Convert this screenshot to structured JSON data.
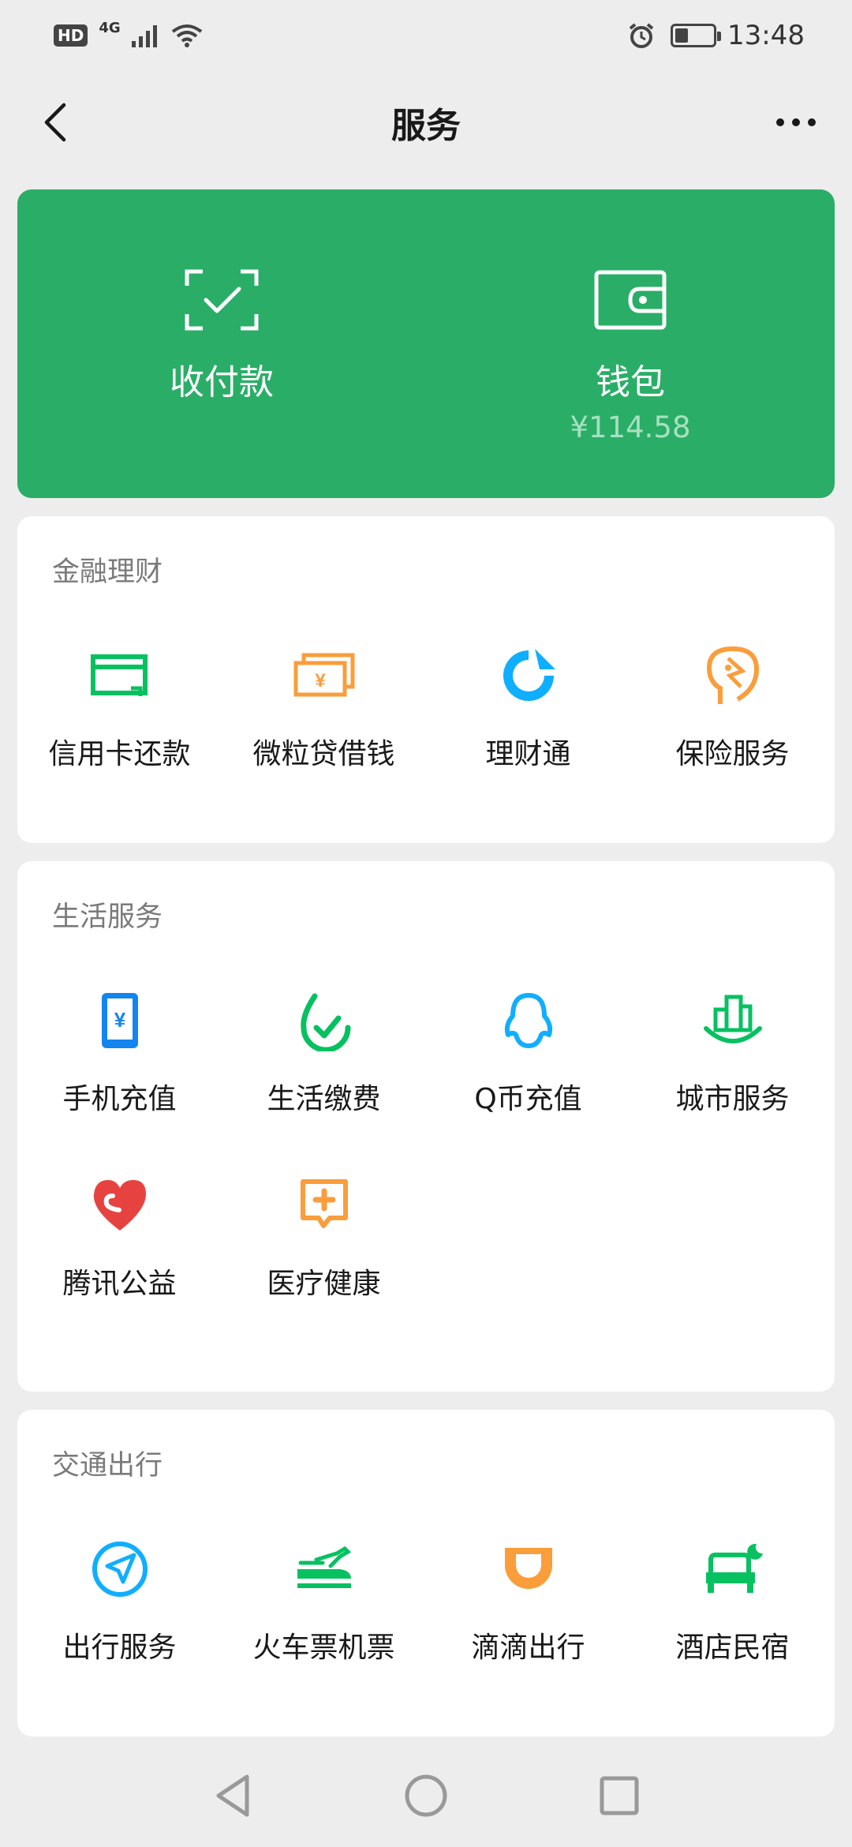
{
  "status_bar": {
    "hd": "HD",
    "network": "4G",
    "time": "13:48",
    "battery_level": 0.35
  },
  "header": {
    "title": "服务"
  },
  "wallet_card": {
    "background": "#2aae67",
    "pay": {
      "label": "收付款",
      "icon": "scan-check-icon"
    },
    "wallet": {
      "label": "钱包",
      "balance": "¥114.58",
      "icon": "wallet-icon"
    }
  },
  "sections": [
    {
      "title": "金融理财",
      "items": [
        {
          "label": "信用卡还款",
          "icon": "credit-card-icon",
          "color": "#07c160"
        },
        {
          "label": "微粒贷借钱",
          "icon": "loan-icon",
          "color": "#fa9d3b"
        },
        {
          "label": "理财通",
          "icon": "wealth-icon",
          "color": "#10aeff"
        },
        {
          "label": "保险服务",
          "icon": "insurance-icon",
          "color": "#fa9d3b"
        }
      ]
    },
    {
      "title": "生活服务",
      "items": [
        {
          "label": "手机充值",
          "icon": "phone-recharge-icon",
          "color": "#1485ee"
        },
        {
          "label": "生活缴费",
          "icon": "utility-bill-icon",
          "color": "#07c160"
        },
        {
          "label": "Q币充值",
          "icon": "qq-coin-icon",
          "color": "#10aeff"
        },
        {
          "label": "城市服务",
          "icon": "city-service-icon",
          "color": "#07c160"
        },
        {
          "label": "腾讯公益",
          "icon": "charity-heart-icon",
          "color": "#e64340"
        },
        {
          "label": "医疗健康",
          "icon": "medical-icon",
          "color": "#fa9d3b"
        }
      ]
    },
    {
      "title": "交通出行",
      "items": [
        {
          "label": "出行服务",
          "icon": "travel-navigation-icon",
          "color": "#10aeff"
        },
        {
          "label": "火车票机票",
          "icon": "train-plane-ticket-icon",
          "color": "#07c160"
        },
        {
          "label": "滴滴出行",
          "icon": "didi-icon",
          "color": "#fa9d3b"
        },
        {
          "label": "酒店民宿",
          "icon": "hotel-bed-icon",
          "color": "#07c160"
        }
      ]
    }
  ]
}
